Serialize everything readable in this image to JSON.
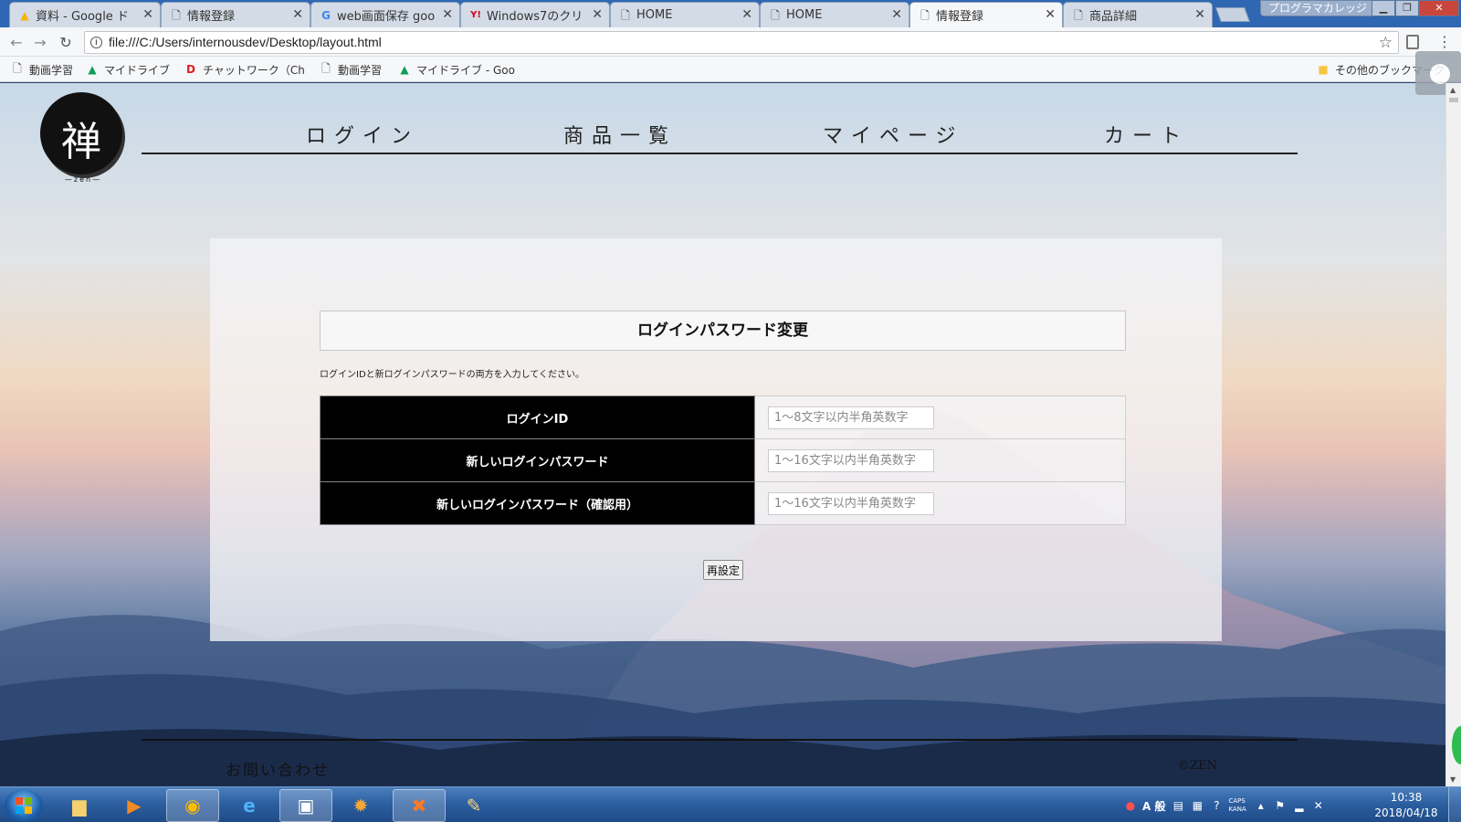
{
  "browser": {
    "tabs": [
      {
        "label": "資料 - Google ド",
        "icon": "drive-icon",
        "active": false
      },
      {
        "label": "情報登録",
        "icon": "page-icon",
        "active": false
      },
      {
        "label": "web画面保存 goo",
        "icon": "google-icon",
        "active": false
      },
      {
        "label": "Windows7のクリ",
        "icon": "yahoo-icon",
        "active": false
      },
      {
        "label": "HOME",
        "icon": "page-icon",
        "active": false
      },
      {
        "label": "HOME",
        "icon": "page-icon",
        "active": false
      },
      {
        "label": "情報登録",
        "icon": "page-icon",
        "active": true
      },
      {
        "label": "商品詳細",
        "icon": "page-icon",
        "active": false
      }
    ],
    "profile_name": "プログラマカレッジ",
    "url": "file:///C:/Users/internousdev/Desktop/layout.html",
    "bookmarks": [
      {
        "label": "動画学習",
        "icon": "page-icon"
      },
      {
        "label": "マイドライブ",
        "icon": "drive-icon"
      },
      {
        "label": "チャットワーク（Ch",
        "icon": "chatwork-icon"
      },
      {
        "label": "動画学習",
        "icon": "page-icon"
      },
      {
        "label": "マイドライブ - Goo",
        "icon": "drive-icon"
      }
    ],
    "other_bookmarks": "その他のブックマーク"
  },
  "site": {
    "logo_char": "禅",
    "logo_sub": "—zen—",
    "nav": [
      "ログイン",
      "商品一覧",
      "マイページ",
      "カート"
    ]
  },
  "form": {
    "title": "ログインパスワード変更",
    "instructions": "ログインIDと新ログインパスワードの両方を入力してください。",
    "rows": [
      {
        "label": "ログインID",
        "placeholder": "1～8文字以内半角英数字"
      },
      {
        "label": "新しいログインパスワード",
        "placeholder": "1～16文字以内半角英数字"
      },
      {
        "label": "新しいログインパスワード（確認用）",
        "placeholder": "1～16文字以内半角英数字"
      }
    ],
    "submit_label": "再設定"
  },
  "footer": {
    "contact": "お問い合わせ",
    "copyright": "©ZEN"
  },
  "taskbar": {
    "ime_mode": "A 般",
    "caps": "CAPS",
    "kana": "KANA",
    "time": "10:38",
    "date": "2018/04/18"
  }
}
